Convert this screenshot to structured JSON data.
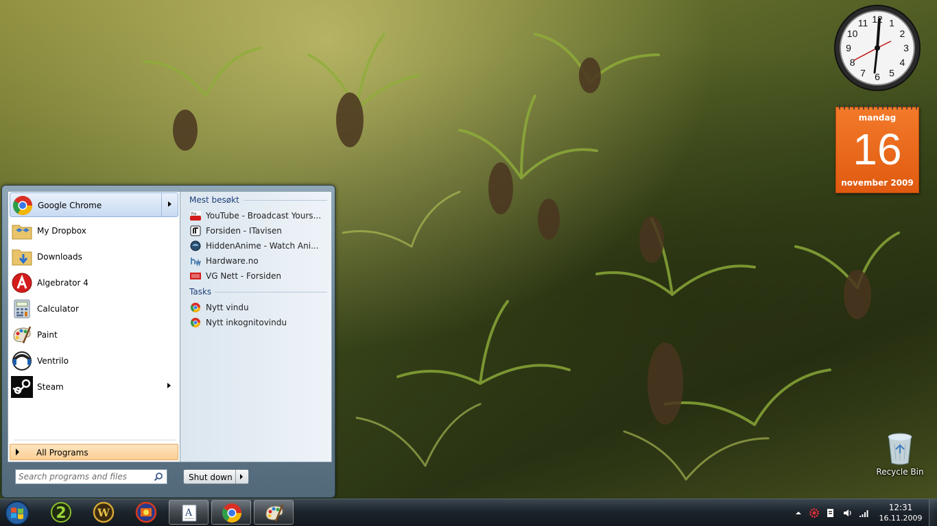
{
  "gadgets": {
    "calendar": {
      "weekday": "mandag",
      "day": "16",
      "month_year": "november 2009"
    },
    "clock": {
      "numerals": [
        "12",
        "1",
        "2",
        "3",
        "4",
        "5",
        "6",
        "7",
        "8",
        "9",
        "10",
        "11"
      ]
    }
  },
  "desktop_icons": {
    "recycle_bin": "Recycle Bin"
  },
  "start_menu": {
    "programs": [
      {
        "label": "Google Chrome",
        "icon": "chrome-icon",
        "has_submenu": true
      },
      {
        "label": "My Dropbox",
        "icon": "dropbox-folder-icon",
        "has_submenu": false
      },
      {
        "label": "Downloads",
        "icon": "downloads-folder-icon",
        "has_submenu": false
      },
      {
        "label": "Algebrator 4",
        "icon": "algebrator-icon",
        "has_submenu": false
      },
      {
        "label": "Calculator",
        "icon": "calculator-icon",
        "has_submenu": false
      },
      {
        "label": "Paint",
        "icon": "paint-icon",
        "has_submenu": false
      },
      {
        "label": "Ventrilo",
        "icon": "ventrilo-icon",
        "has_submenu": false
      },
      {
        "label": "Steam",
        "icon": "steam-icon",
        "has_submenu": true
      }
    ],
    "all_programs": "All Programs",
    "search_placeholder": "Search programs and files",
    "shutdown_label": "Shut down",
    "jump_list": {
      "most_visited_title": "Mest besøkt",
      "most_visited": [
        {
          "label": "YouTube - Broadcast Yours...",
          "icon": "youtube-icon"
        },
        {
          "label": "Forsiden - ITavisen",
          "icon": "itavisen-icon"
        },
        {
          "label": "HiddenAnime - Watch Ani...",
          "icon": "hiddenanime-icon"
        },
        {
          "label": "Hardware.no",
          "icon": "hardware-icon"
        },
        {
          "label": "VG Nett - Forsiden",
          "icon": "vg-icon"
        }
      ],
      "tasks_title": "Tasks",
      "tasks": [
        {
          "label": "Nytt vindu",
          "icon": "chrome-icon"
        },
        {
          "label": "Nytt inkognitovindu",
          "icon": "chrome-icon"
        }
      ]
    }
  },
  "taskbar": {
    "pinned": [
      "star-wars-battlefront-2-icon",
      "world-of-warcraft-icon",
      "game-launcher-icon",
      "text-editor-icon",
      "chrome-icon",
      "paint-icon"
    ],
    "tray": {
      "time": "12:31",
      "date": "16.11.2009"
    }
  }
}
